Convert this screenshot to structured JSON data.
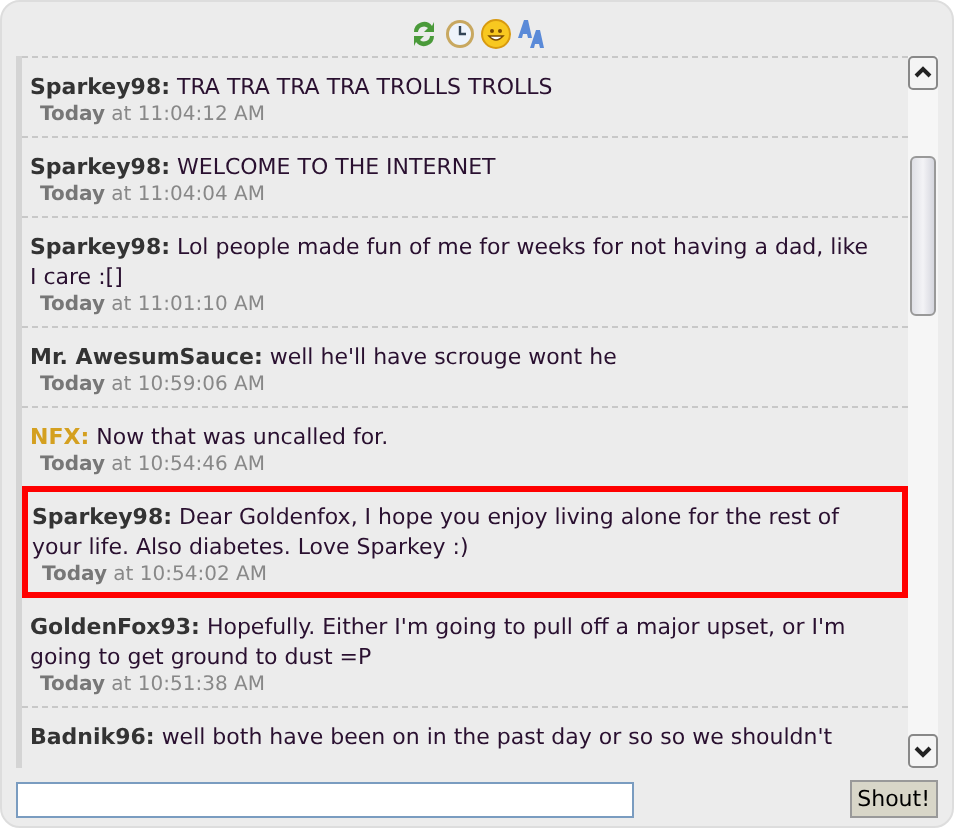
{
  "messages": [
    {
      "user": "Sparkey98:",
      "color": "#333333",
      "text": "TRA TRA TRA TRA TROLLS TROLLS",
      "day": "Today",
      "time": "at 11:04:12 AM",
      "highlighted": false
    },
    {
      "user": "Sparkey98:",
      "color": "#333333",
      "text": "WELCOME TO THE INTERNET",
      "day": "Today",
      "time": "at 11:04:04 AM",
      "highlighted": false
    },
    {
      "user": "Sparkey98:",
      "color": "#333333",
      "text": "Lol people made fun of me for weeks for not having a dad, like I care :[]",
      "day": "Today",
      "time": "at 11:01:10 AM",
      "highlighted": false
    },
    {
      "user": "Mr. AwesumSauce:",
      "color": "#333333",
      "text": "well he'll have scrouge wont he",
      "day": "Today",
      "time": "at 10:59:06 AM",
      "highlighted": false
    },
    {
      "user": "NFX:",
      "color": "#d4a020",
      "text": "Now that was uncalled for.",
      "day": "Today",
      "time": "at 10:54:46 AM",
      "highlighted": false
    },
    {
      "user": "Sparkey98:",
      "color": "#333333",
      "text": "Dear Goldenfox, I hope you enjoy living alone for the rest of your life. Also diabetes. Love Sparkey :)",
      "day": "Today",
      "time": "at 10:54:02 AM",
      "highlighted": true
    },
    {
      "user": "GoldenFox93:",
      "color": "#333333",
      "text": "Hopefully. Either I'm going to pull off a major upset, or I'm going to get ground to dust  =P",
      "day": "Today",
      "time": "at 10:51:38 AM",
      "highlighted": false
    },
    {
      "user": "Badnik96:",
      "color": "#333333",
      "text": "well both have been on in the past day or so so we shouldn't",
      "highlighted": false
    }
  ],
  "shout_button": "Shout!"
}
